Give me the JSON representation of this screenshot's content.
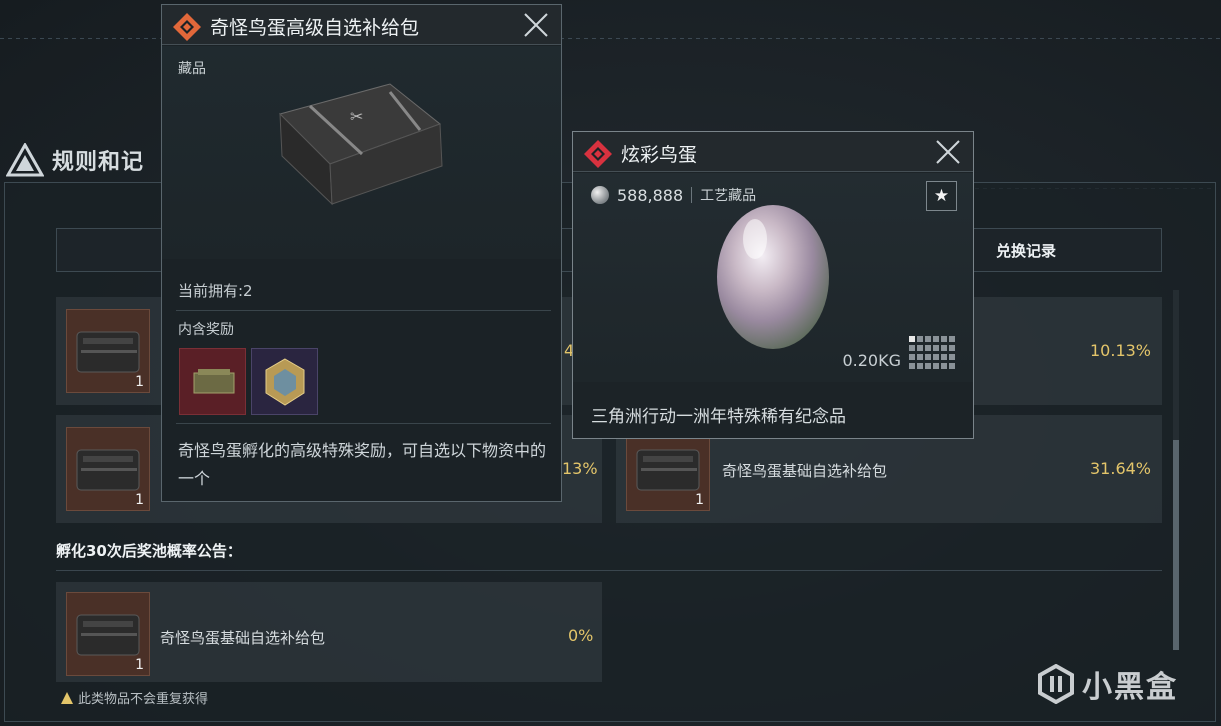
{
  "background": {
    "panel_title": "规则和记"
  },
  "tabs": {
    "record_label": "兑换记录"
  },
  "rows": [
    {
      "count": "1",
      "name": "",
      "pct": "10.13%"
    },
    {
      "count": "1",
      "name": "奇怪鸟蛋基础自选补给包",
      "pct": "31.64%"
    }
  ],
  "left_rows": [
    {
      "count": "1",
      "pct_partial": "4"
    },
    {
      "count": "1",
      "pct_partial": "13%"
    }
  ],
  "section": {
    "title": "孵化30次后奖池概率公告：",
    "rows": [
      {
        "count": "1",
        "name": "奇怪鸟蛋基础自选补给包",
        "pct": "0%"
      }
    ],
    "note": "此类物品不会重复获得"
  },
  "popup1": {
    "title": "奇怪鸟蛋高级自选补给包",
    "category": "藏品",
    "owned": "当前拥有:2",
    "rewards_label": "内含奖励",
    "description": "奇怪鸟蛋孵化的高级特殊奖励，可自选以下物资中的一个"
  },
  "popup2": {
    "title": "炫彩鸟蛋",
    "price": "588,888",
    "category": "工艺藏品",
    "fav_icon": "★",
    "weight": "0.20KG",
    "description": "三角洲行动一洲年特殊稀有纪念品"
  },
  "watermark": {
    "text": "小黑盒"
  },
  "colors": {
    "accent_gold": "#e3c56a",
    "badge_red": "#d8323f",
    "badge_orange": "#e2683a"
  }
}
